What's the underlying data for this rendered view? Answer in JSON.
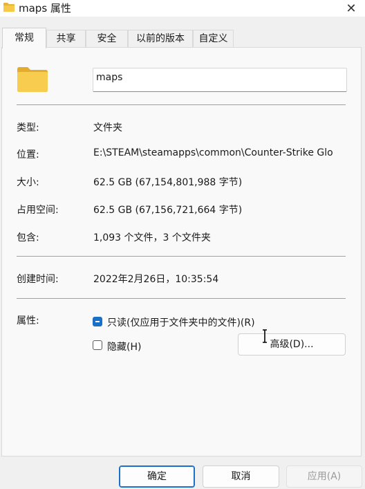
{
  "window": {
    "title": "maps 属性",
    "close_glyph": "✕"
  },
  "tabs": [
    {
      "label": "常规",
      "active": true
    },
    {
      "label": "共享"
    },
    {
      "label": "安全"
    },
    {
      "label": "以前的版本"
    },
    {
      "label": "自定义"
    }
  ],
  "general": {
    "name_value": "maps",
    "rows": {
      "type": {
        "label": "类型:",
        "value": "文件夹"
      },
      "location": {
        "label": "位置:",
        "value": "E:\\STEAM\\steamapps\\common\\Counter-Strike Glo"
      },
      "size": {
        "label": "大小:",
        "value": "62.5 GB (67,154,801,988 字节)"
      },
      "on_disk": {
        "label": "占用空间:",
        "value": "62.5 GB (67,156,721,664 字节)"
      },
      "contains": {
        "label": "包含:",
        "value": "1,093 个文件，3 个文件夹"
      },
      "created": {
        "label": "创建时间:",
        "value": "2022年2月26日，10:35:54"
      }
    },
    "attributes": {
      "label": "属性:",
      "readonly_label": "只读(仅应用于文件夹中的文件)(R)",
      "readonly_state": "indeterminate",
      "hidden_label": "隐藏(H)",
      "hidden_checked": false,
      "advanced_label": "高级(D)..."
    }
  },
  "footer": {
    "ok_label": "确定",
    "cancel_label": "取消",
    "apply_label": "应用(A)"
  },
  "colors": {
    "accent": "#1a6fc9",
    "folder": "#f5c542"
  }
}
